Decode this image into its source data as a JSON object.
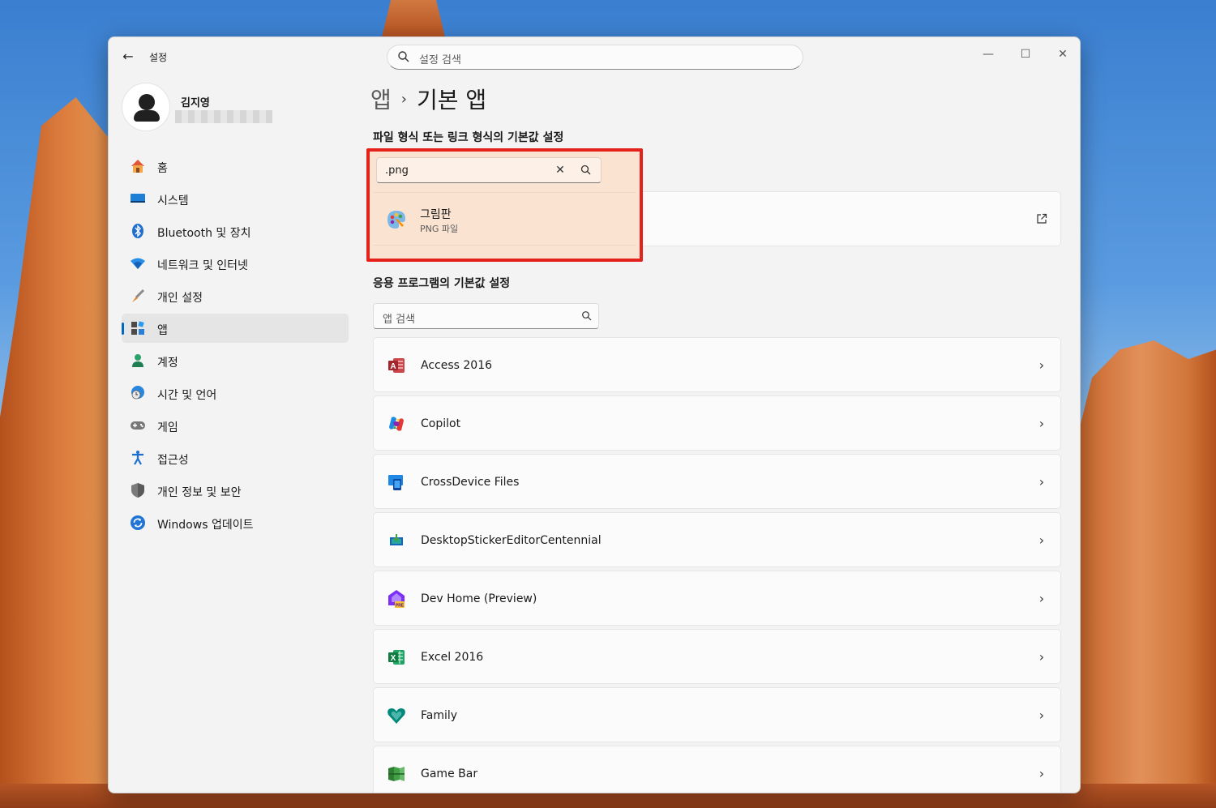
{
  "window": {
    "app_title": "설정",
    "search_placeholder": "설정 검색"
  },
  "profile": {
    "name": "김지영"
  },
  "sidebar": {
    "items": [
      {
        "label": "홈",
        "icon": "home-icon",
        "active": false
      },
      {
        "label": "시스템",
        "icon": "system-icon",
        "active": false
      },
      {
        "label": "Bluetooth 및 장치",
        "icon": "bluetooth-icon",
        "active": false
      },
      {
        "label": "네트워크 및 인터넷",
        "icon": "wifi-icon",
        "active": false
      },
      {
        "label": "개인 설정",
        "icon": "brush-icon",
        "active": false
      },
      {
        "label": "앱",
        "icon": "apps-icon",
        "active": true
      },
      {
        "label": "계정",
        "icon": "account-icon",
        "active": false
      },
      {
        "label": "시간 및 언어",
        "icon": "globe-clock-icon",
        "active": false
      },
      {
        "label": "게임",
        "icon": "gamepad-icon",
        "active": false
      },
      {
        "label": "접근성",
        "icon": "accessibility-icon",
        "active": false
      },
      {
        "label": "개인 정보 및 보안",
        "icon": "shield-icon",
        "active": false
      },
      {
        "label": "Windows 업데이트",
        "icon": "update-icon",
        "active": false
      }
    ]
  },
  "main": {
    "breadcrumb": {
      "parent": "앱",
      "current": "기본 앱"
    },
    "filetype_section": {
      "title": "파일 형식 또는 링크 형식의 기본값 설정",
      "input_value": ".png",
      "result": {
        "app_name": "그림판",
        "file_type": "PNG 파일"
      }
    },
    "apps_section": {
      "title": "응용 프로그램의 기본값 설정",
      "search_placeholder": "앱 검색",
      "apps": [
        {
          "name": "Access 2016",
          "icon": "access-icon"
        },
        {
          "name": "Copilot",
          "icon": "copilot-icon"
        },
        {
          "name": "CrossDevice Files",
          "icon": "crossdevice-icon"
        },
        {
          "name": "DesktopStickerEditorCentennial",
          "icon": "sticker-editor-icon"
        },
        {
          "name": "Dev Home (Preview)",
          "icon": "devhome-icon"
        },
        {
          "name": "Excel 2016",
          "icon": "excel-icon"
        },
        {
          "name": "Family",
          "icon": "family-icon"
        },
        {
          "name": "Game Bar",
          "icon": "gamebar-icon"
        }
      ]
    }
  },
  "colors": {
    "accent": "#0067c0",
    "highlight_border": "#e5211c",
    "window_bg": "#f3f3f3"
  }
}
